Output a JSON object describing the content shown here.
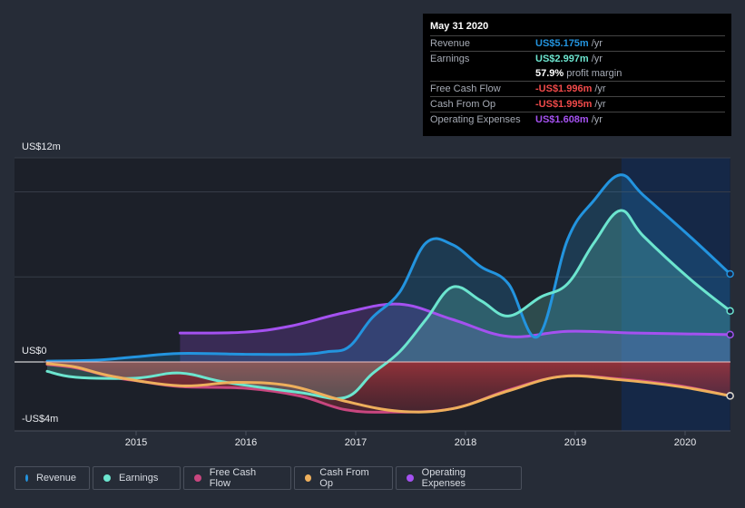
{
  "tooltip": {
    "date": "May 31 2020",
    "rows": [
      {
        "label": "Revenue",
        "value": "US$5.175m",
        "unit": "/yr",
        "color": "#2394df"
      },
      {
        "label": "Earnings",
        "value": "US$2.997m",
        "unit": "/yr",
        "color": "#6ce5cf"
      },
      {
        "label": "",
        "value": "57.9%",
        "unit": "profit margin",
        "color": "#ffffff"
      },
      {
        "label": "Free Cash Flow",
        "value": "-US$1.996m",
        "unit": "/yr",
        "color": "#f14a4a"
      },
      {
        "label": "Cash From Op",
        "value": "-US$1.995m",
        "unit": "/yr",
        "color": "#f14a4a"
      },
      {
        "label": "Operating Expenses",
        "value": "US$1.608m",
        "unit": "/yr",
        "color": "#a451f0"
      }
    ]
  },
  "legend": [
    {
      "label": "Revenue",
      "color": "#2394df"
    },
    {
      "label": "Earnings",
      "color": "#6ce5cf"
    },
    {
      "label": "Free Cash Flow",
      "color": "#c8467f"
    },
    {
      "label": "Cash From Op",
      "color": "#eeaf5c"
    },
    {
      "label": "Operating Expenses",
      "color": "#a451f0"
    }
  ],
  "chart_data": {
    "type": "area",
    "title": "",
    "xlabel": "",
    "ylabel": "",
    "y_tick_labels": [
      "US$12m",
      "US$0",
      "-US$4m"
    ],
    "y_ticks": [
      12,
      0,
      -4
    ],
    "x_tick_labels": [
      "2015",
      "2016",
      "2017",
      "2018",
      "2019",
      "2020"
    ],
    "x_ticks": [
      2015,
      2016,
      2017,
      2018,
      2019,
      2020
    ],
    "xlim": [
      2013.9,
      2020.41
    ],
    "ylim": [
      -4,
      12
    ],
    "gridlines": [
      12,
      10,
      5
    ],
    "highlight_range": [
      2019.42,
      2020.41
    ],
    "legend_position": "bottom",
    "series": [
      {
        "name": "Revenue",
        "color": "#2394df",
        "x": [
          2014.19,
          2014.62,
          2015.0,
          2015.4,
          2016.0,
          2016.49,
          2016.74,
          2016.94,
          2017.15,
          2017.4,
          2017.64,
          2017.88,
          2018.14,
          2018.39,
          2018.66,
          2018.93,
          2019.17,
          2019.41,
          2019.62,
          2020.04,
          2020.41
        ],
        "y": [
          0.05,
          0.1,
          0.3,
          0.5,
          0.45,
          0.45,
          0.6,
          0.9,
          2.6,
          4.1,
          7.0,
          6.9,
          5.6,
          4.6,
          1.5,
          7.2,
          9.5,
          11.0,
          9.8,
          7.4,
          5.175
        ]
      },
      {
        "name": "Earnings",
        "color": "#6ce5cf",
        "x": [
          2014.19,
          2014.45,
          2015.0,
          2015.4,
          2015.82,
          2016.49,
          2016.9,
          2017.15,
          2017.4,
          2017.64,
          2017.88,
          2018.14,
          2018.39,
          2018.68,
          2018.93,
          2019.17,
          2019.41,
          2019.62,
          2020.04,
          2020.41
        ],
        "y": [
          -0.55,
          -0.9,
          -0.95,
          -0.65,
          -1.2,
          -1.8,
          -2.1,
          -0.7,
          0.6,
          2.5,
          4.4,
          3.6,
          2.7,
          3.8,
          4.6,
          7.0,
          8.9,
          7.4,
          4.9,
          2.997
        ]
      },
      {
        "name": "Free Cash Flow",
        "color": "#c8467f",
        "x": [
          2014.19,
          2014.45,
          2014.79,
          2015.0,
          2015.4,
          2016.0,
          2016.49,
          2016.9,
          2017.31,
          2017.88,
          2018.39,
          2018.88,
          2019.41,
          2019.95,
          2020.41
        ],
        "y": [
          -0.15,
          -0.35,
          -0.9,
          -1.1,
          -1.45,
          -1.55,
          -2.0,
          -2.8,
          -2.95,
          -2.75,
          -1.65,
          -0.85,
          -1.0,
          -1.4,
          -1.996
        ]
      },
      {
        "name": "Cash From Op",
        "color": "#eeaf5c",
        "x": [
          2014.19,
          2014.45,
          2014.79,
          2015.4,
          2015.91,
          2016.4,
          2016.9,
          2017.4,
          2017.88,
          2018.39,
          2018.88,
          2019.41,
          2019.95,
          2020.41
        ],
        "y": [
          -0.1,
          -0.3,
          -0.85,
          -1.4,
          -1.2,
          -1.4,
          -2.3,
          -2.9,
          -2.75,
          -1.7,
          -0.85,
          -1.05,
          -1.45,
          -1.995
        ]
      },
      {
        "name": "Operating Expenses",
        "color": "#a451f0",
        "x": [
          2015.4,
          2015.98,
          2016.4,
          2016.9,
          2017.4,
          2017.88,
          2018.39,
          2018.93,
          2019.55,
          2020.41
        ],
        "y": [
          1.7,
          1.75,
          2.1,
          2.9,
          3.4,
          2.5,
          1.5,
          1.8,
          1.7,
          1.608
        ]
      }
    ]
  }
}
